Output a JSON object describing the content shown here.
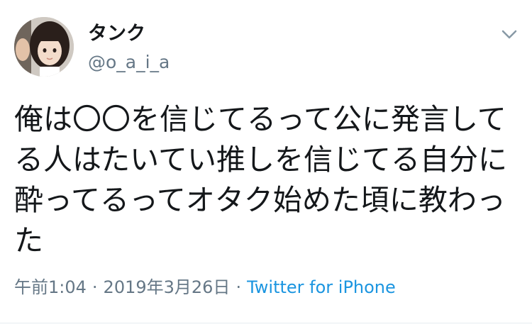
{
  "user": {
    "display_name": "タンク",
    "handle": "@o_a_i_a"
  },
  "tweet": {
    "text": "俺は〇〇を信じてるって公に発言してる人はたいてい推しを信じてる自分に酔ってるってオタク始めた頃に教わった",
    "time": "午前1:04",
    "separator": "·",
    "date": "2019年3月26日",
    "source": "Twitter for iPhone"
  },
  "icons": {
    "menu": "chevron-down-icon",
    "avatar": "profile-photo"
  },
  "colors": {
    "text": "#14171a",
    "secondary": "#657786",
    "link": "#1b95e0"
  }
}
